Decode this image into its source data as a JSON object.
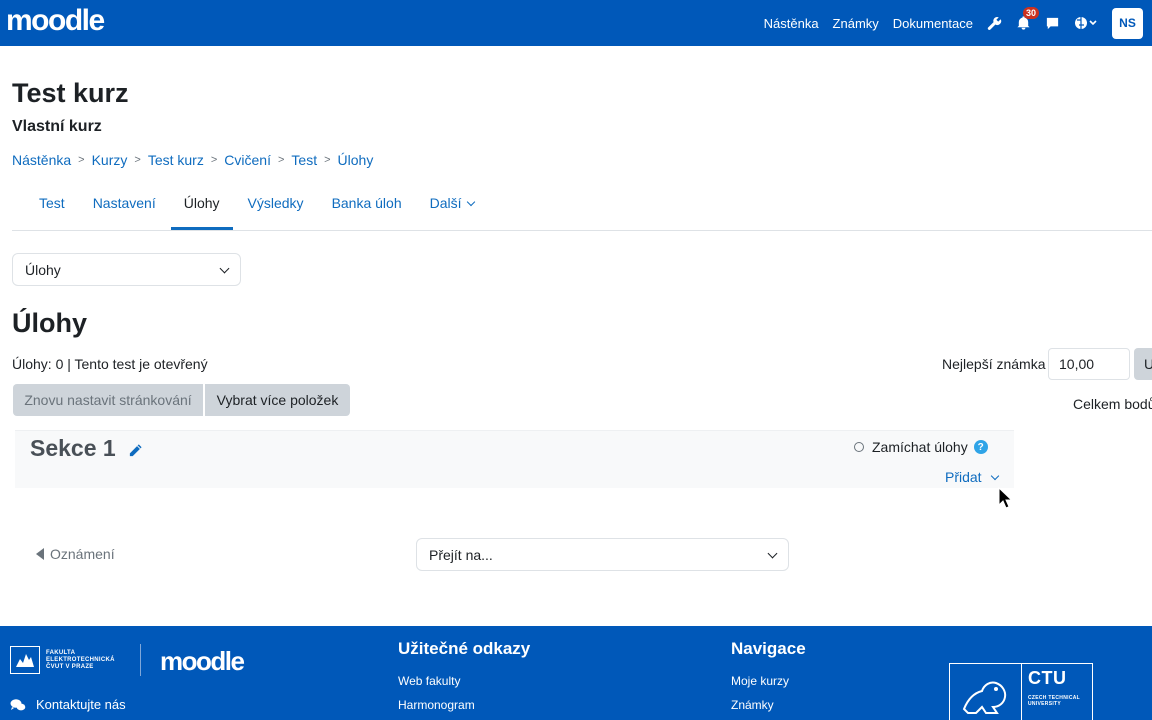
{
  "navbar": {
    "logo": "moodle",
    "links": [
      "Nástěnka",
      "Známky",
      "Dokumentace"
    ],
    "notifications_count": "30",
    "avatar_initials": "NS"
  },
  "course": {
    "title": "Test kurz",
    "subtitle": "Vlastní kurz"
  },
  "breadcrumb": [
    "Nástěnka",
    "Kurzy",
    "Test kurz",
    "Cvičení",
    "Test",
    "Úlohy"
  ],
  "breadcrumb_sep": ">",
  "tabs": [
    {
      "label": "Test",
      "active": false
    },
    {
      "label": "Nastavení",
      "active": false
    },
    {
      "label": "Úlohy",
      "active": true
    },
    {
      "label": "Výsledky",
      "active": false
    },
    {
      "label": "Banka úloh",
      "active": false
    },
    {
      "label": "Další",
      "active": false
    }
  ],
  "select_view": {
    "value": "Úlohy"
  },
  "page": {
    "title": "Úlohy",
    "status": "Úlohy: 0 | Tento test je otevřený"
  },
  "buttons": {
    "repaginate": "Znovu nastavit stránkování",
    "select_multiple": "Vybrat více položek"
  },
  "grade": {
    "label": "Nejlepší známka",
    "value": "10,00",
    "save_label": "U",
    "total_label": "Celkem bodů"
  },
  "section": {
    "title": "Sekce 1",
    "shuffle_label": "Zamíchat úlohy",
    "help_glyph": "?",
    "add_label": "Přidat"
  },
  "activity_nav": {
    "prev_label": "Oznámení",
    "jump_label": "Přejít na..."
  },
  "footer": {
    "fel_text_lines": [
      "FAKULTA",
      "ELEKTROTECHNICKÁ",
      "ČVUT V PRAZE"
    ],
    "moodle": "moodle",
    "contact": "Kontaktujte nás",
    "useful_links_title": "Užitečné odkazy",
    "useful_links": [
      "Web fakulty",
      "Harmonogram"
    ],
    "navigation_title": "Navigace",
    "navigation_links": [
      "Moje kurzy",
      "Známky"
    ],
    "ctu_abbr": "CTU",
    "ctu_lines": [
      "CZECH TECHNICAL",
      "UNIVERSITY"
    ]
  },
  "colors": {
    "brand_blue": "#0058b9",
    "link_blue": "#0f6cbf",
    "badge_red": "#ca3120",
    "help_blue": "#2fa4e7"
  }
}
